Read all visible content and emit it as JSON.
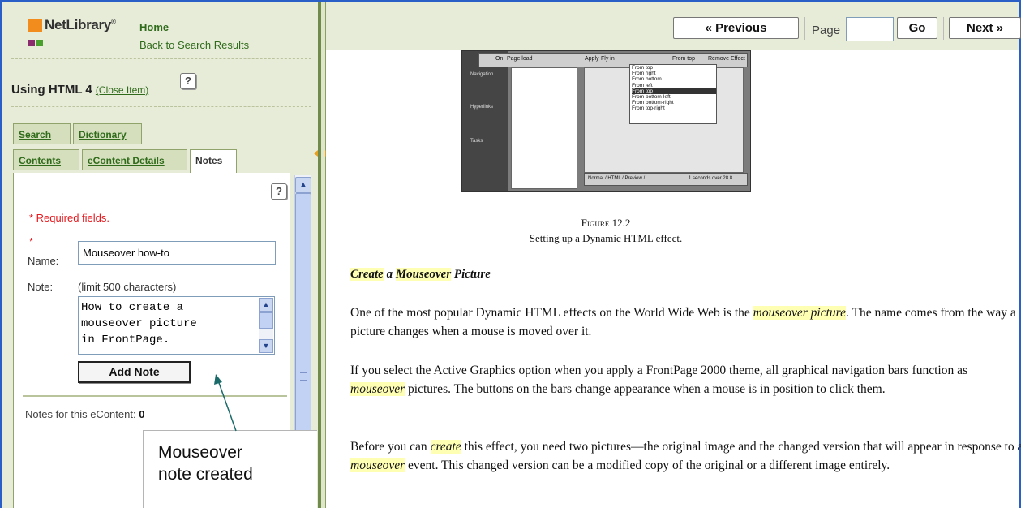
{
  "sidebar": {
    "logo_text": "NetLibrary",
    "logo_tm": "®",
    "home_link": "Home",
    "back_link": "Back to Search Results",
    "item_title": "Using HTML 4",
    "close_item": "(Close Item)",
    "help_glyph": "?",
    "tabs_row1": [
      "Search",
      "Dictionary"
    ],
    "tabs_row2": [
      "Contents",
      "eContent Details",
      "Notes"
    ],
    "active_tab": "Notes"
  },
  "notes_form": {
    "required_text": "* Required fields.",
    "required_star": "*",
    "name_label": "Name:",
    "name_value": "Mouseover how-to",
    "note_label": "Note:",
    "note_limit": "(limit 500 characters)",
    "note_value": "How to create a\nmouseover picture\nin FrontPage.",
    "add_button": "Add Note",
    "notes_count_label": "Notes for this eContent:",
    "notes_count_value": "0"
  },
  "callout": {
    "line1": "Mouseover",
    "line2": "note created"
  },
  "toolbar": {
    "previous": "« Previous",
    "page_label": "Page",
    "page_value": "",
    "go": "Go",
    "next": "Next »"
  },
  "figure": {
    "menu_on": "On",
    "menu_onvalue": "Page load",
    "menu_apply": "Apply",
    "menu_applyvalue": "Fly in",
    "menu_from": "From top",
    "menu_remove": "Remove Effect",
    "dropdown_items": [
      "From top",
      "From right",
      "From bottom",
      "From left",
      "From top",
      "From bottom-left",
      "From bottom-right",
      "From top-right"
    ],
    "dropdown_selected_index": 4,
    "side_items": [
      "Navigation",
      "Hyperlinks",
      "Tasks"
    ],
    "status_tabs": "Normal / HTML / Preview /",
    "status_right": "1 seconds over 28.8",
    "label": "Figure 12.2",
    "caption": "Setting up a Dynamic HTML effect."
  },
  "article": {
    "heading_parts": [
      "Create",
      " a ",
      "Mouseover",
      " Picture"
    ],
    "para1": "One of the most popular Dynamic HTML effects on the World Wide Web is the |mouseover picture|. The name comes from the way a picture changes when a mouse is moved over it.",
    "para2": "If you select the Active Graphics option when you apply a FrontPage 2000 theme, all graphical navigation bars function as |mouseover| pictures. The buttons on the bars change appearance when a mouse is in position to click them.",
    "para3": "Before you can |create| this effect, you need two pictures—the original image and the changed version that will appear in response to a |mouseover| event. This changed version can be a modified copy of the original or a different image entirely."
  }
}
